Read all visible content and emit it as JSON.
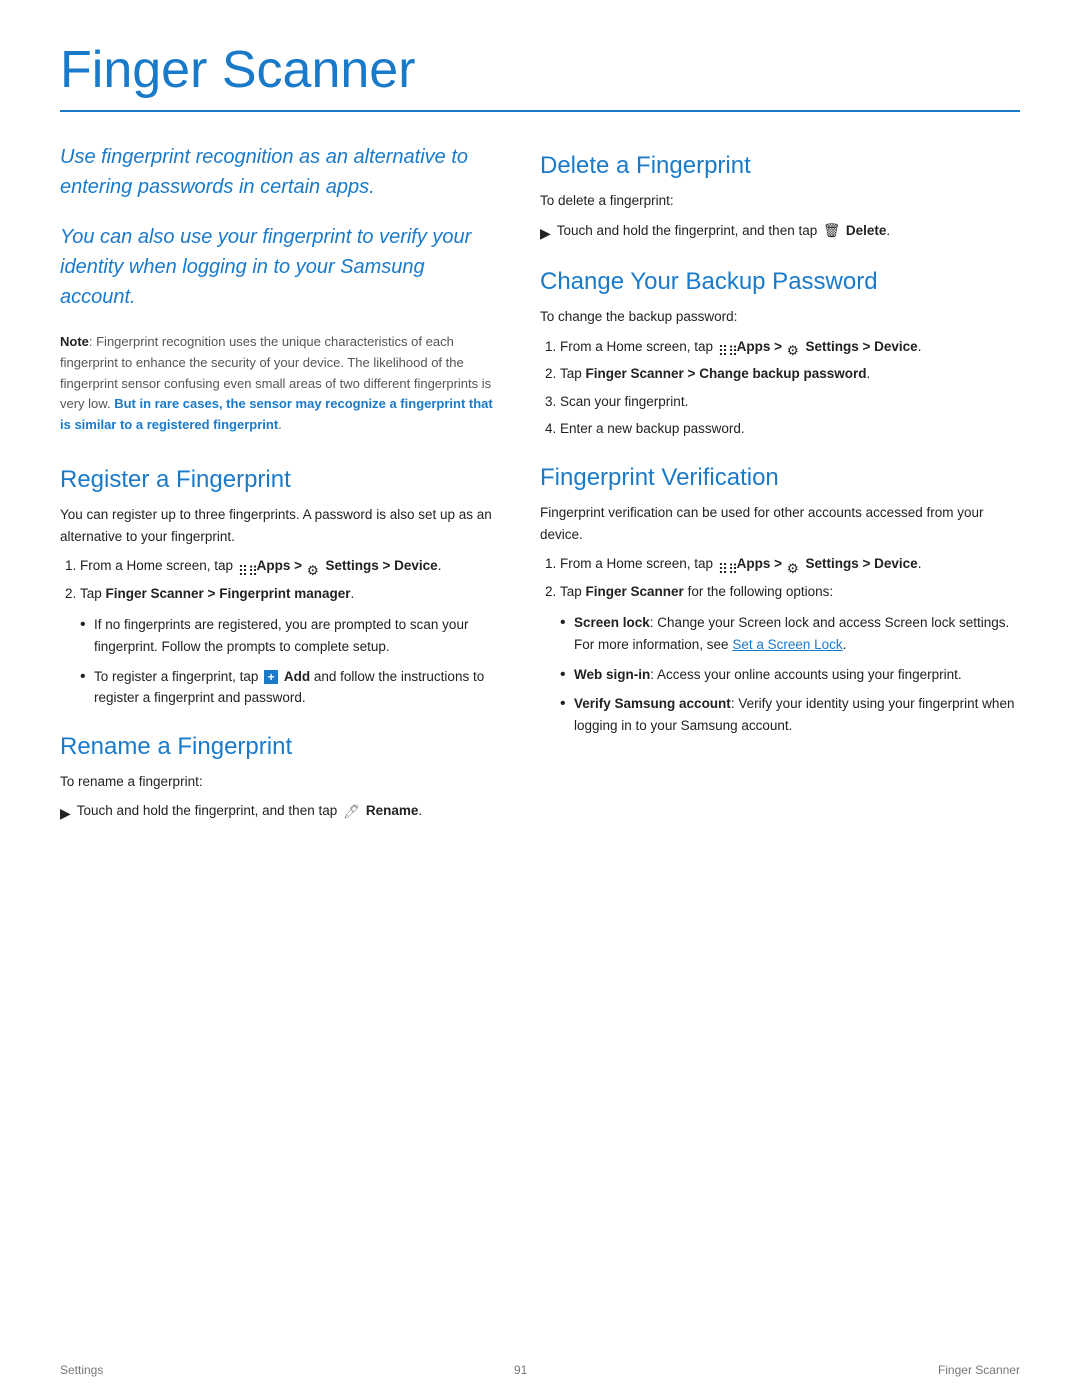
{
  "page": {
    "title": "Finger Scanner",
    "footer": {
      "left": "Settings",
      "center": "91",
      "right": "Finger Scanner"
    }
  },
  "left_col": {
    "intro1": "Use fingerprint recognition as an alternative to entering passwords in certain apps.",
    "intro2": "You can also use your fingerprint to verify your identity when logging in to your Samsung account.",
    "note_label": "Note",
    "note_text": ": Fingerprint recognition uses the unique characteristics of each fingerprint to enhance the security of your device. The likelihood of the fingerprint sensor confusing even small areas of two different fingerprints is very low. ",
    "note_bold_blue": "But in rare cases, the sensor may recognize a fingerprint that is similar to a registered fingerprint",
    "note_end": ".",
    "register_heading": "Register a Fingerprint",
    "register_intro": "You can register up to three fingerprints. A password is also set up as an alternative to your fingerprint.",
    "register_steps": [
      {
        "text_prefix": "From a Home screen, tap ",
        "apps_icon": true,
        "apps_label": "Apps > ",
        "gear_icon": true,
        "step_suffix": " Settings > Device."
      },
      {
        "text": "Tap Finger Scanner > Fingerprint manager."
      }
    ],
    "register_bullets": [
      "If no fingerprints are registered, you are prompted to scan your fingerprint. Follow the prompts to complete setup.",
      "To register a fingerprint, tap"
    ],
    "register_bullet2_plus": true,
    "register_bullet2_suffix": " Add and follow the instructions to register a fingerprint and password.",
    "rename_heading": "Rename a Fingerprint",
    "rename_intro": "To rename a fingerprint:",
    "rename_arrow": "Touch and hold the fingerprint, and then tap",
    "rename_pencil": true,
    "rename_suffix": " Rename."
  },
  "right_col": {
    "delete_heading": "Delete a Fingerprint",
    "delete_intro": "To delete a fingerprint:",
    "delete_arrow": "Touch and hold the fingerprint, and then tap",
    "delete_trash": true,
    "delete_suffix": " Delete.",
    "change_heading": "Change Your Backup Password",
    "change_intro": "To change the backup password:",
    "change_steps": [
      {
        "text_prefix": "From a Home screen, tap ",
        "apps_icon": true,
        "apps_label": "Apps > ",
        "gear_icon": true,
        "step_suffix": " Settings > Device."
      },
      {
        "text": "Tap Finger Scanner > Change backup password."
      },
      {
        "text": "Scan your fingerprint."
      },
      {
        "text": "Enter a new backup password."
      }
    ],
    "fingerprint_heading": "Fingerprint Verification",
    "fingerprint_intro": "Fingerprint verification can be used for other accounts accessed from your device.",
    "fingerprint_steps": [
      {
        "text_prefix": "From a Home screen, tap ",
        "apps_icon": true,
        "apps_label": "Apps > ",
        "gear_icon": true,
        "step_suffix": " Settings > Device."
      },
      {
        "text": "Tap Finger Scanner for the following options:"
      }
    ],
    "fingerprint_bullets": [
      {
        "label": "Screen lock",
        "text": ": Change your Screen lock and access Screen lock settings. For more information, see ",
        "link": "Set a Screen Lock",
        "text_end": "."
      },
      {
        "label": "Web sign-in",
        "text": ": Access your online accounts using your fingerprint."
      },
      {
        "label": "Verify Samsung account",
        "text": ": Verify your identity using your fingerprint when logging in to your Samsung account."
      }
    ]
  }
}
